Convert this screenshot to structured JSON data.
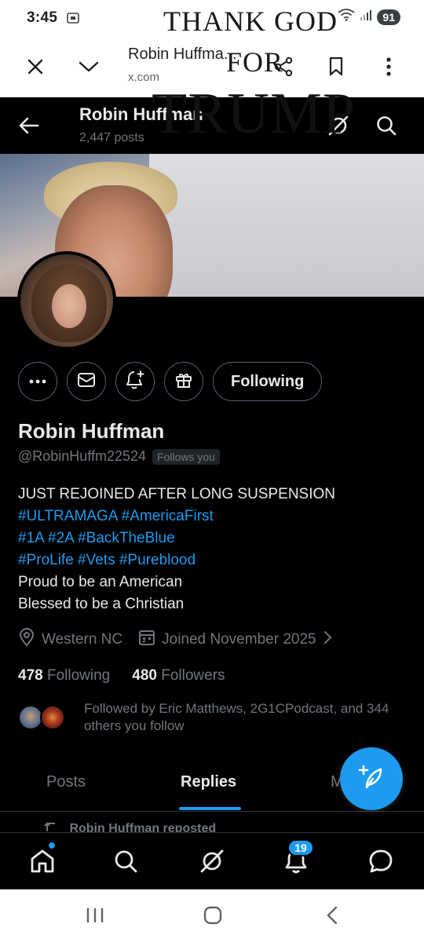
{
  "status_bar": {
    "time": "3:45",
    "battery": "91"
  },
  "browser_bar": {
    "title": "Robin Huffma...",
    "url": "x.com"
  },
  "header": {
    "name": "Robin Huffman",
    "post_count": "2,447 posts"
  },
  "banner": {
    "line1": "THANK GOD",
    "line2": "FOR",
    "line3": "TRUMP"
  },
  "actions": {
    "following_label": "Following"
  },
  "profile": {
    "display_name": "Robin Huffman",
    "handle": "@RobinHuffm22524",
    "follows_you": "Follows you",
    "bio": {
      "line1": "JUST REJOINED AFTER LONG SUSPENSION",
      "line2": "#ULTRAMAGA #AmericaFirst",
      "line3": "#1A #2A #BackTheBlue",
      "line4": "#ProLife #Vets #Pureblood",
      "line5": "Proud to be an American",
      "line6": "Blessed to be a Christian"
    },
    "location": "Western NC",
    "joined": "Joined November 2025",
    "following_count": "478",
    "following_label": "Following",
    "followers_count": "480",
    "followers_label": "Followers",
    "followed_by": "Followed by Eric Matthews, 2G1CPodcast, and 344 others you follow"
  },
  "tabs": [
    {
      "label": "Posts"
    },
    {
      "label": "Replies"
    },
    {
      "label": "M"
    }
  ],
  "feed_peek": {
    "text": "Robin Huffman reposted"
  },
  "bottom_nav": {
    "notification_count": "19"
  },
  "colors": {
    "accent": "#1d9bf0",
    "background": "#000000",
    "text_primary": "#e7e9ea",
    "text_secondary": "#71767b"
  }
}
